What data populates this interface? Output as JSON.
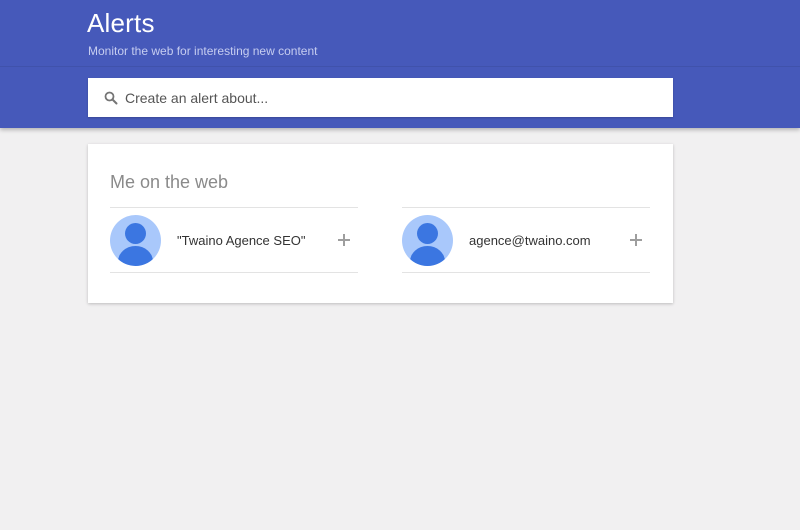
{
  "header": {
    "title": "Alerts",
    "subtitle": "Monitor the web for interesting new content"
  },
  "search": {
    "placeholder": "Create an alert about...",
    "icon": "search-icon"
  },
  "me_on_web": {
    "title": "Me on the web",
    "suggestions": [
      {
        "label": "\"Twaino Agence SEO\"",
        "icon": "avatar",
        "action_icon": "plus-icon"
      },
      {
        "label": "agence@twaino.com",
        "icon": "avatar",
        "action_icon": "plus-icon"
      }
    ]
  },
  "colors": {
    "header_bg": "#4659ba",
    "page_bg": "#f1f0f1",
    "avatar_bg": "#a9c8fb",
    "avatar_fg": "#3b76e1"
  }
}
